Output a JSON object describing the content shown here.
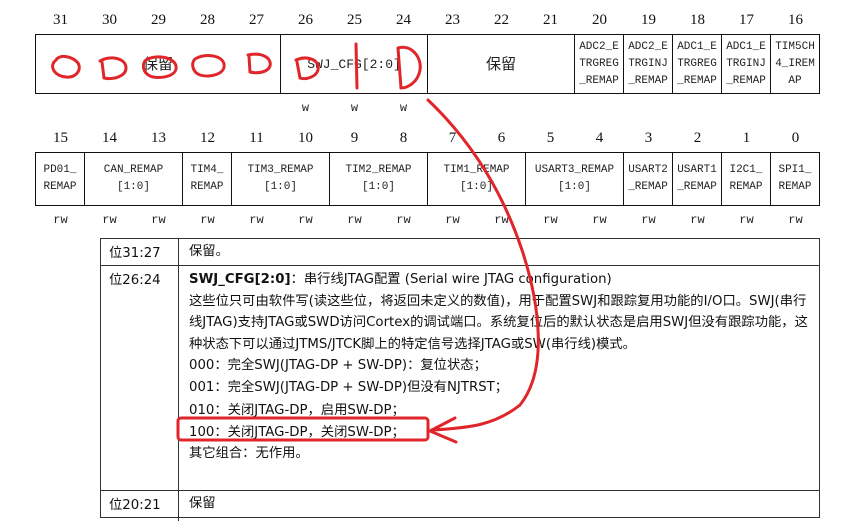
{
  "bit_numbers_high": [
    "31",
    "30",
    "29",
    "28",
    "27",
    "26",
    "25",
    "24",
    "23",
    "22",
    "21",
    "20",
    "19",
    "18",
    "17",
    "16"
  ],
  "bit_numbers_low": [
    "15",
    "14",
    "13",
    "12",
    "11",
    "10",
    "9",
    "8",
    "7",
    "6",
    "5",
    "4",
    "3",
    "2",
    "1",
    "0"
  ],
  "fields_high": [
    {
      "label": "保留"
    },
    {
      "label": "SWJ_CFG[2:0]"
    },
    {
      "label": "保留"
    },
    {
      "label": "ADC2_E\nTRGREG\n_REMAP"
    },
    {
      "label": "ADC2_E\nTRGINJ\n_REMAP"
    },
    {
      "label": "ADC1_E\nTRGREG\n_REMAP"
    },
    {
      "label": "ADC1_E\nTRGINJ\n_REMAP"
    },
    {
      "label": "TIM5CH\n4_IREM\nAP"
    }
  ],
  "fields_low": [
    {
      "label": "PD01_\nREMAP"
    },
    {
      "label": "CAN_REMAP\n[1:0]"
    },
    {
      "label": "TIM4_\nREMAP"
    },
    {
      "label": "TIM3_REMAP\n[1:0]"
    },
    {
      "label": "TIM2_REMAP\n[1:0]"
    },
    {
      "label": "TIM1_REMAP\n[1:0]"
    },
    {
      "label": "USART3_REMAP\n[1:0]"
    },
    {
      "label": "USART2\n_REMAP"
    },
    {
      "label": "USART1\n_REMAP"
    },
    {
      "label": "I2C1_\nREMAP"
    },
    {
      "label": "SPI1_\nREMAP"
    }
  ],
  "access_high": [
    "w",
    "w",
    "w"
  ],
  "access_low": [
    "rw",
    "rw",
    "rw",
    "rw",
    "rw",
    "rw",
    "rw",
    "rw",
    "rw",
    "rw",
    "rw",
    "rw",
    "rw",
    "rw",
    "rw",
    "rw"
  ],
  "desc": {
    "row1": {
      "bits": "位31:27",
      "text": "保留。"
    },
    "row2": {
      "bits": "位26:24",
      "title_name": "SWJ_CFG[2:0]",
      "title_rest": "：串行线JTAG配置 (Serial wire JTAG configuration)",
      "para1": "这些位只可由软件写(读这些位，将返回未定义的数值)，用于配置SWJ和跟踪复用功能的I/O口。SWJ(串行线JTAG)支持JTAG或SWD访问Cortex的调试端口。系统复位后的默认状态是启用SWJ但没有跟踪功能，这种状态下可以通过JTMS/JTCK脚上的特定信号选择JTAG或SW(串行线)模式。",
      "opt000": "000：完全SWJ(JTAG-DP + SW-DP)：复位状态；",
      "opt001": "001：完全SWJ(JTAG-DP + SW-DP)但没有NJTRST；",
      "opt010": "010：关闭JTAG-DP，启用SW-DP；",
      "opt100": "100：关闭JTAG-DP，关闭SW-DP；",
      "other": "其它组合：无作用。"
    },
    "row3": {
      "bits": "位20:21",
      "text": "保留"
    }
  },
  "annotation_color": "#e0262a"
}
